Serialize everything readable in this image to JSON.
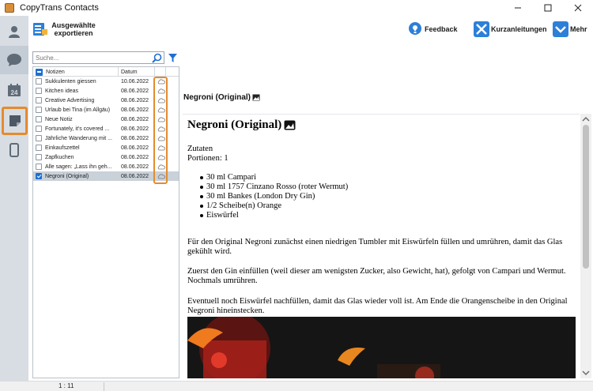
{
  "window": {
    "title": "CopyTrans Contacts"
  },
  "toolbar": {
    "export_label": "Ausgewählte exportieren",
    "feedback_label": "Feedback",
    "guides_label": "Kurzanleitungen",
    "more_label": "Mehr"
  },
  "search": {
    "placeholder": "Suche..."
  },
  "list": {
    "col_notes": "Notizen",
    "col_date": "Datum",
    "rows": [
      {
        "title": "Sukkulenten giessen",
        "date": "10.06.2022"
      },
      {
        "title": "Kitchen ideas",
        "date": "08.06.2022"
      },
      {
        "title": "Creative Advertising",
        "date": "08.06.2022"
      },
      {
        "title": "Urlaub bei Tina (im Allgäu)",
        "date": "08.06.2022"
      },
      {
        "title": "Neue Notiz",
        "date": "08.06.2022"
      },
      {
        "title": "Fortunately, it's covered ...",
        "date": "08.06.2022"
      },
      {
        "title": "Jährliche Wanderung mit ...",
        "date": "08.06.2022"
      },
      {
        "title": "Einkaufszettel",
        "date": "08.06.2022"
      },
      {
        "title": "Zapfkuchen",
        "date": "08.06.2022"
      },
      {
        "title": "Alle sagen: „Lass ihn geh...",
        "date": "08.06.2022"
      },
      {
        "title": "Negroni (Original)",
        "date": "08.06.2022"
      }
    ]
  },
  "note": {
    "header": "Negroni (Original)",
    "title": "Negroni (Original)",
    "zutaten": "Zutaten",
    "portionen": "Portionen: 1",
    "ingredients": [
      "30 ml Campari",
      "30 ml 1757 Cinzano Rosso (roter Wermut)",
      "30 ml Bankes (London Dry Gin)",
      "1/2 Scheibe(n) Orange",
      "Eiswürfel"
    ],
    "para1": "Für den Original Negroni zunächst einen niedrigen Tumbler mit Eiswürfeln füllen und umrühren, damit das Glas gekühlt wird.",
    "para2": "Zuerst den Gin einfüllen (weil dieser am wenigsten Zucker, also Gewicht, hat), gefolgt von Campari und Wermut. Nochmals umrühren.",
    "para3": "Eventuell noch Eiswürfel nachfüllen, damit das Glas wieder voll ist. Am Ende die Orangenscheibe in den Original Negroni hineinstecken."
  },
  "status": {
    "position": "1 : 11"
  },
  "colors": {
    "accent": "#1f6fd1",
    "highlight": "#e48b2e",
    "rail": "#d8dde3"
  }
}
